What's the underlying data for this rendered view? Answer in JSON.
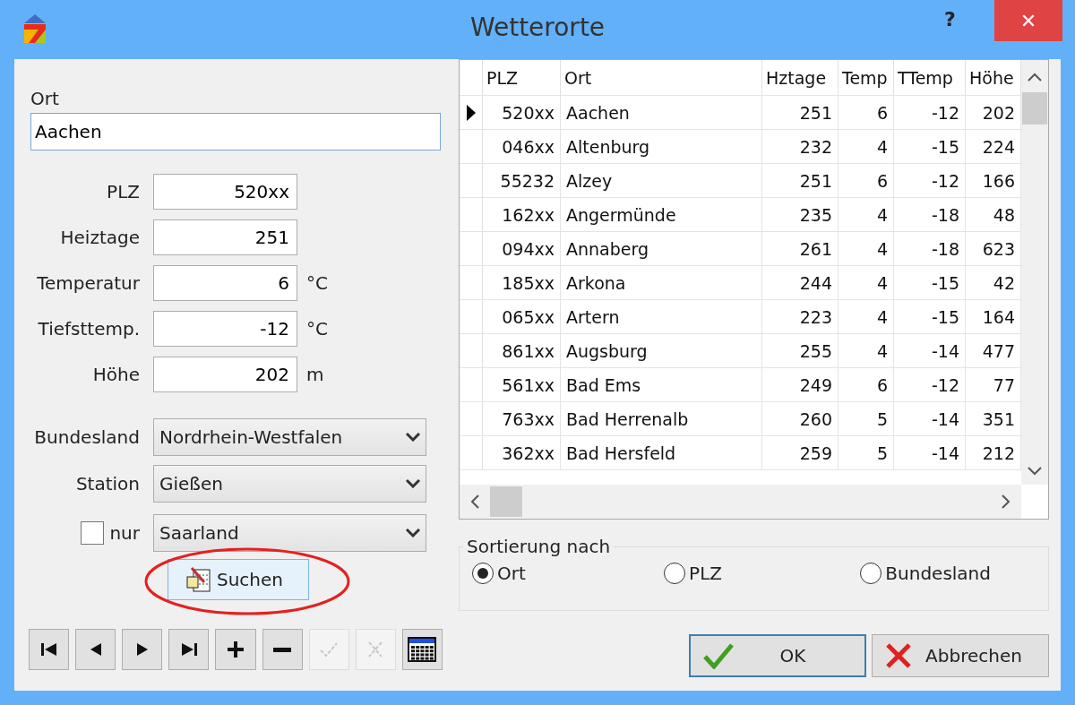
{
  "window": {
    "title": "Wetterorte",
    "help": "?",
    "close": "✕"
  },
  "ort": {
    "label": "Ort",
    "value": "Aachen"
  },
  "fields": [
    {
      "label": "PLZ",
      "value": "520xx"
    },
    {
      "label": "Heiztage",
      "value": "251"
    },
    {
      "label": "Temperatur",
      "value": "6",
      "unit": "°C"
    },
    {
      "label": "Tiefsttemp.",
      "value": "-12",
      "unit": "°C"
    },
    {
      "label": "Höhe",
      "value": "202",
      "unit": "m"
    }
  ],
  "combos": [
    {
      "label": "Bundesland",
      "value": "Nordrhein-Westfalen"
    },
    {
      "label": "Station",
      "value": "Gießen"
    },
    {
      "label": "nur",
      "value": "Saarland",
      "kind": "checkbox",
      "checked": false
    }
  ],
  "search_button": "Suchen",
  "toolbar": [
    {
      "kind": "first",
      "disabled": false
    },
    {
      "kind": "prev",
      "disabled": false
    },
    {
      "kind": "next",
      "disabled": false
    },
    {
      "kind": "last",
      "disabled": false
    },
    {
      "kind": "add",
      "disabled": false
    },
    {
      "kind": "remove",
      "disabled": false
    },
    {
      "kind": "confirm",
      "disabled": true
    },
    {
      "kind": "discard",
      "disabled": true
    },
    {
      "kind": "grid",
      "disabled": false
    }
  ],
  "table": {
    "columns": [
      "PLZ",
      "Ort",
      "Hztage",
      "Temp",
      "TTemp",
      "Höhe"
    ],
    "rows": [
      {
        "cells": [
          "520xx",
          "Aachen",
          "251",
          "6",
          "-12",
          "202"
        ],
        "selected": true
      },
      {
        "cells": [
          "046xx",
          "Altenburg",
          "232",
          "4",
          "-15",
          "224"
        ],
        "selected": false
      },
      {
        "cells": [
          "55232",
          "Alzey",
          "251",
          "6",
          "-12",
          "166"
        ],
        "selected": false
      },
      {
        "cells": [
          "162xx",
          "Angermünde",
          "235",
          "4",
          "-18",
          "48"
        ],
        "selected": false
      },
      {
        "cells": [
          "094xx",
          "Annaberg",
          "261",
          "4",
          "-18",
          "623"
        ],
        "selected": false
      },
      {
        "cells": [
          "185xx",
          "Arkona",
          "244",
          "4",
          "-15",
          "42"
        ],
        "selected": false
      },
      {
        "cells": [
          "065xx",
          "Artern",
          "223",
          "4",
          "-15",
          "164"
        ],
        "selected": false
      },
      {
        "cells": [
          "861xx",
          "Augsburg",
          "255",
          "4",
          "-14",
          "477"
        ],
        "selected": false
      },
      {
        "cells": [
          "561xx",
          "Bad Ems",
          "249",
          "6",
          "-12",
          "77"
        ],
        "selected": false
      },
      {
        "cells": [
          "763xx",
          "Bad Herrenalb",
          "260",
          "5",
          "-14",
          "351"
        ],
        "selected": false
      },
      {
        "cells": [
          "362xx",
          "Bad Hersfeld",
          "259",
          "5",
          "-14",
          "212"
        ],
        "selected": false
      }
    ]
  },
  "sort": {
    "title": "Sortierung nach",
    "options": [
      {
        "label": "Ort",
        "selected": true
      },
      {
        "label": "PLZ",
        "selected": false
      },
      {
        "label": "Bundesland",
        "selected": false
      }
    ]
  },
  "buttons": [
    {
      "kind": "ok",
      "label": "OK"
    },
    {
      "kind": "cancel",
      "label": "Abbrechen"
    }
  ]
}
